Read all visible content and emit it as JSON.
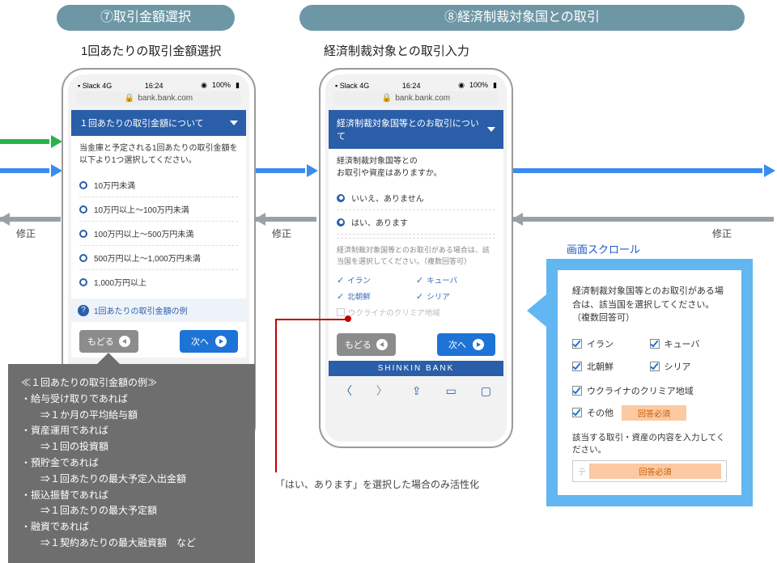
{
  "badge7": "⑦取引金額選択",
  "badge8": "⑧経済制裁対象国との取引",
  "sub7": "1回あたりの取引金額選択",
  "sub8": "経済制裁対象との取引入力",
  "status": {
    "left": "Slack   4G",
    "time": "16:24",
    "right": "100%"
  },
  "url": "bank.bank.com",
  "phoneA": {
    "title": "１回あたりの取引金額について",
    "lead": "当金庫と予定される1回あたりの取引金額を以下より1つ選択してください。",
    "opts": [
      "10万円未満",
      "10万円以上～100万円未満",
      "100万円以上～500万円未満",
      "500万円以上～1,000万円未満",
      "1,000万円以上"
    ],
    "help": "1回あたりの取引金額の例"
  },
  "phoneB": {
    "title": "経済制裁対象国等とのお取引について",
    "lead1": "経済制裁対象国等との",
    "lead2": "お取引や資産はありますか。",
    "optNo": "いいえ、ありません",
    "optYes": "はい、あります",
    "subLead": "経済制裁対象国等とのお取引がある場合は、該当国を選択してください。（複数回答可）",
    "countries": [
      "イラン",
      "キューバ",
      "北朝鮮",
      "シリア"
    ],
    "countryGrey": "ウクライナのクリミア地域"
  },
  "btnBack": "もどる",
  "btnNext": "次へ",
  "shinkin": "SHINKIN  BANK",
  "fix": "修正",
  "callout": {
    "title": "≪１回あたりの取引金額の例≫",
    "l1a": "・給与受け取りであれば",
    "l1b": "　　⇒１か月の平均給与額",
    "l2a": "・資産運用であれば",
    "l2b": "　　⇒１回の投資額",
    "l3a": "・預貯金であれば",
    "l3b": "　　⇒１回あたりの最大予定入出金額",
    "l4a": "・振込振替であれば",
    "l4b": "　　⇒１回あたりの最大予定額",
    "l5a": "・融資であれば",
    "l5b": "　　⇒１契約あたりの最大融資額　など"
  },
  "redNote": "「はい、あります」を選択した場合のみ活性化",
  "scrollLabel": "画面スクロール",
  "scroll": {
    "lead": "経済制裁対象国等とのお取引がある場合は、該当国を選択してください。（複数回答可）",
    "countries": [
      "イラン",
      "キューバ",
      "北朝鮮",
      "シリア",
      "ウクライナのクリミア地域",
      "その他"
    ],
    "req": "回答必須",
    "foot": "該当する取引・資産の内容を入力してください。",
    "inputHint": "テ"
  }
}
